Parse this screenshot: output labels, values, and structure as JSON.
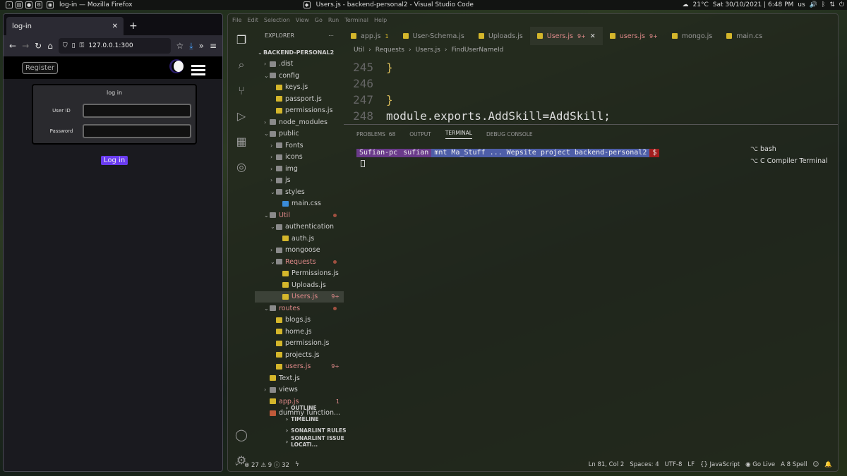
{
  "topbar": {
    "firefox_title": "log-in — Mozilla Firefox",
    "vscode_title": "Users.js - backend-personal2 - Visual Studio Code",
    "weather": "21°C",
    "datetime": "Sat 30/10/2021 | 6:48 PM",
    "locale": "us"
  },
  "firefox": {
    "tab_title": "log-in",
    "url": "127.0.0.1:300",
    "site": {
      "register_label": "Register",
      "login_heading": "log in",
      "userid_label": "User ID",
      "password_label": "Password",
      "login_button": "Log in"
    }
  },
  "vscode": {
    "menu": [
      "File",
      "Edit",
      "Selection",
      "View",
      "Go",
      "Run",
      "Terminal",
      "Help"
    ],
    "explorer_title": "EXPLORER",
    "root": "BACKEND-PERSONAL2",
    "tree": [
      {
        "label": ".dist",
        "type": "folder",
        "depth": 1,
        "open": false
      },
      {
        "label": "config",
        "type": "folder",
        "depth": 1,
        "open": true
      },
      {
        "label": "keys.js",
        "type": "js",
        "depth": 2
      },
      {
        "label": "passport.js",
        "type": "js",
        "depth": 2
      },
      {
        "label": "permissions.js",
        "type": "js",
        "depth": 2
      },
      {
        "label": "node_modules",
        "type": "folder",
        "depth": 1,
        "open": false
      },
      {
        "label": "public",
        "type": "folder",
        "depth": 1,
        "open": true
      },
      {
        "label": "Fonts",
        "type": "folder",
        "depth": 2,
        "open": false
      },
      {
        "label": "icons",
        "type": "folder",
        "depth": 2,
        "open": false
      },
      {
        "label": "img",
        "type": "folder",
        "depth": 2,
        "open": false
      },
      {
        "label": "js",
        "type": "folder",
        "depth": 2,
        "open": false
      },
      {
        "label": "styles",
        "type": "folder",
        "depth": 2,
        "open": true
      },
      {
        "label": "main.css",
        "type": "css",
        "depth": 3
      },
      {
        "label": "Util",
        "type": "folder",
        "depth": 1,
        "open": true,
        "modified": true
      },
      {
        "label": "authentication",
        "type": "folder",
        "depth": 2,
        "open": true
      },
      {
        "label": "auth.js",
        "type": "js",
        "depth": 3
      },
      {
        "label": "mongoose",
        "type": "folder",
        "depth": 2,
        "open": false
      },
      {
        "label": "Requests",
        "type": "folder",
        "depth": 2,
        "open": true,
        "modified": true
      },
      {
        "label": "Permissions.js",
        "type": "js",
        "depth": 3
      },
      {
        "label": "Uploads.js",
        "type": "js",
        "depth": 3
      },
      {
        "label": "Users.js",
        "type": "js",
        "depth": 3,
        "badge": "9+",
        "selected": true
      },
      {
        "label": "routes",
        "type": "folder",
        "depth": 1,
        "open": true,
        "modified": true
      },
      {
        "label": "blogs.js",
        "type": "js",
        "depth": 2
      },
      {
        "label": "home.js",
        "type": "js",
        "depth": 2
      },
      {
        "label": "permission.js",
        "type": "js",
        "depth": 2
      },
      {
        "label": "projects.js",
        "type": "js",
        "depth": 2
      },
      {
        "label": "users.js",
        "type": "js",
        "depth": 2,
        "badge": "9+"
      },
      {
        "label": "Text.js",
        "type": "js",
        "depth": 1
      },
      {
        "label": "views",
        "type": "folder",
        "depth": 1,
        "open": false
      },
      {
        "label": "app.js",
        "type": "js",
        "depth": 1,
        "badge": "1"
      },
      {
        "label": "dummy function...",
        "type": "other",
        "depth": 1
      }
    ],
    "panels": [
      "OUTLINE",
      "TIMELINE",
      "SONARLINT RULES",
      "SONARLINT ISSUE LOCATI..."
    ],
    "tabs": [
      {
        "label": "app.js",
        "mark": "1"
      },
      {
        "label": "User-Schema.js",
        "mark": ""
      },
      {
        "label": "Uploads.js",
        "mark": ""
      },
      {
        "label": "Users.js",
        "mark": "9+",
        "active": true
      },
      {
        "label": "users.js",
        "mark": "9+"
      },
      {
        "label": "mongo.js",
        "mark": ""
      },
      {
        "label": "main.cs",
        "mark": ""
      }
    ],
    "breadcrumb": [
      "Util",
      "Requests",
      "Users.js",
      "FindUserNameId"
    ],
    "code": [
      {
        "ln": "245",
        "text": "}"
      },
      {
        "ln": "246",
        "text": ""
      },
      {
        "ln": "247",
        "text": "}"
      },
      {
        "ln": "248",
        "text": "module.exports.AddSkill=AddSkill;"
      }
    ],
    "terminal_tabs": [
      "PROBLEMS",
      "68",
      "OUTPUT",
      "TERMINAL",
      "DEBUG CONSOLE"
    ],
    "prompt": {
      "host": "Sufian-pc",
      "user": "sufian",
      "path": "mnt  Ma_Stuff  ...  Wepsite project  backend-personal2",
      "symbol": "$"
    },
    "shells": [
      "bash",
      "C Compiler Terminal"
    ],
    "status": {
      "problems": "27",
      "warnings": "9",
      "info": "32",
      "position": "Ln 81, Col 2",
      "spaces": "Spaces: 4",
      "encoding": "UTF-8",
      "eol": "LF",
      "language": "JavaScript",
      "golive": "Go Live",
      "spell": "8 Spell"
    }
  }
}
